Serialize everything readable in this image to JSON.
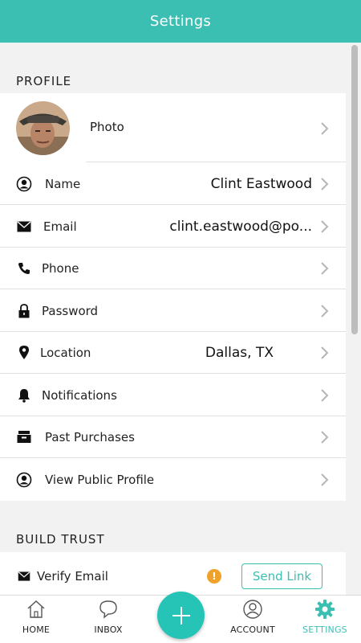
{
  "header": {
    "title": "Settings"
  },
  "profile_section": {
    "title": "PROFILE",
    "photo_label": "Photo",
    "rows": [
      {
        "label": "Name",
        "value": "Clint Eastwood",
        "icon": "user-circle-icon"
      },
      {
        "label": "Email",
        "value": "clint.eastwood@po...",
        "icon": "envelope-icon"
      },
      {
        "label": "Phone",
        "value": "",
        "icon": "phone-icon"
      },
      {
        "label": "Password",
        "value": "",
        "icon": "lock-icon"
      },
      {
        "label": "Location",
        "value": "Dallas, TX",
        "icon": "map-pin-icon"
      },
      {
        "label": "Notifications",
        "value": "",
        "icon": "bell-icon"
      },
      {
        "label": "Past Purchases",
        "value": "",
        "icon": "archive-icon"
      },
      {
        "label": "View Public Profile",
        "value": "",
        "icon": "user-circle-icon"
      }
    ]
  },
  "trust_section": {
    "title": "BUILD TRUST",
    "verify_email_label": "Verify Email",
    "warning_glyph": "!",
    "send_link_label": "Send Link"
  },
  "tabbar": {
    "home": "HOME",
    "inbox": "INBOX",
    "account": "ACCOUNT",
    "settings": "SETTINGS",
    "fab_icon": "plus-icon"
  },
  "colors": {
    "accent": "#3bbfb2",
    "warning": "#f0a12a"
  }
}
